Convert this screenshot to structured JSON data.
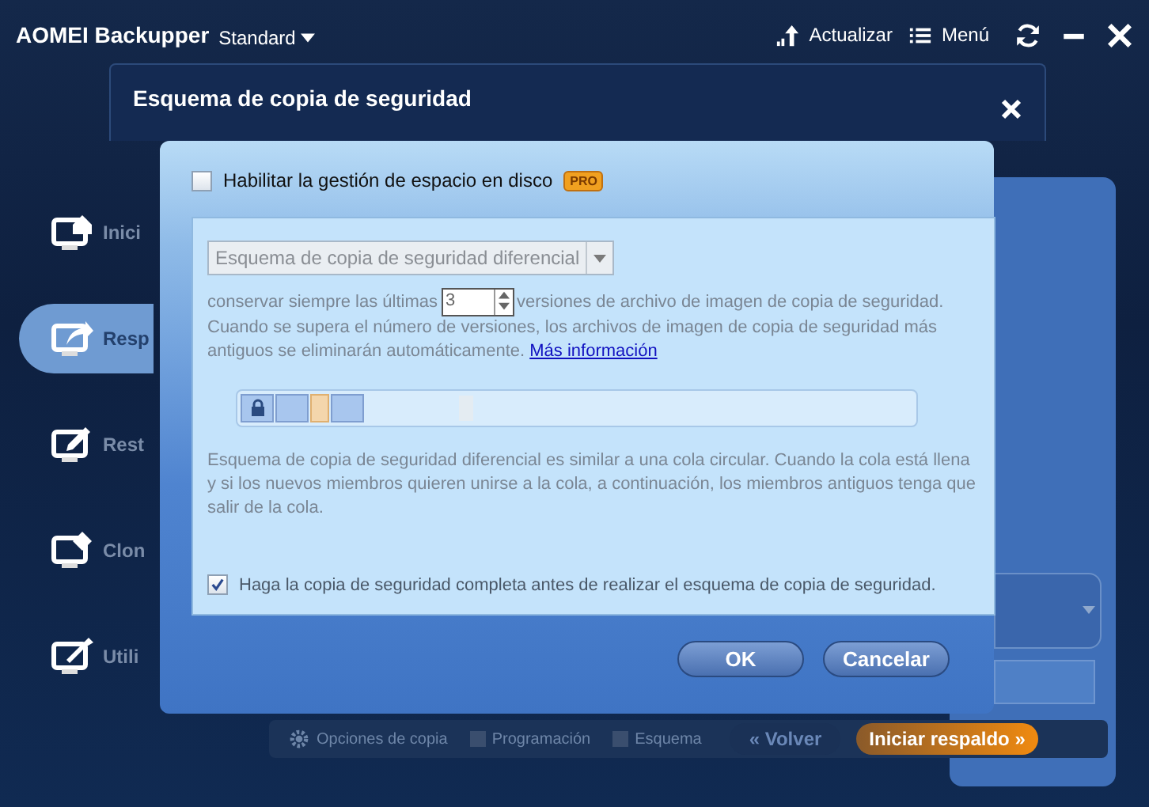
{
  "app": {
    "name": "AOMEI Backupper",
    "edition": "Standard"
  },
  "toolbar": [
    {
      "kind": "upgrade",
      "label": "Actualizar"
    },
    {
      "kind": "menu",
      "label": "Menú"
    }
  ],
  "sidebar": {
    "items": [
      {
        "kind": "home",
        "label": "Inici",
        "selected": false
      },
      {
        "kind": "backup",
        "label": "Resp",
        "selected": true
      },
      {
        "kind": "restore",
        "label": "Rest",
        "selected": false
      },
      {
        "kind": "clone",
        "label": "Clon",
        "selected": false
      },
      {
        "kind": "tools",
        "label": "Utili",
        "selected": false
      }
    ]
  },
  "dialog": {
    "title": "Esquema de copia de seguridad",
    "disk_management": {
      "label": "Habilitar la gestión de espacio en disco",
      "checked": false,
      "badge": "PRO"
    },
    "scheme": {
      "value": "Esquema de copia de seguridad diferencial",
      "disabled": true
    },
    "keep_before": "conservar siempre las últimas",
    "keep_count": "3",
    "keep_after": "versiones de archivo de imagen de copia de seguridad.",
    "explanation": "Cuando se supera el número de versiones, los archivos de imagen de copia de seguridad más antiguos se eliminarán automáticamente.",
    "more_link": "Más información",
    "queue": [
      {
        "kind": "locked"
      },
      {
        "kind": "full"
      },
      {
        "kind": "diff"
      },
      {
        "kind": "full"
      }
    ],
    "description": "Esquema de copia de seguridad diferencial es similar a una cola circular. Cuando la cola está llena y si los nuevos miembros quieren unirse a la cola, a continuación, los miembros antiguos tenga que salir de la cola.",
    "full_first": {
      "label": "Haga la copia de seguridad completa antes de realizar el esquema de copia de seguridad.",
      "checked": true
    },
    "buttons": [
      "OK",
      "Cancelar"
    ]
  },
  "bottom_bar": {
    "items": [
      {
        "kind": "options",
        "label": "Opciones de copia"
      },
      {
        "kind": "check",
        "label": "Programación",
        "checked": false
      },
      {
        "kind": "check",
        "label": "Esquema",
        "checked": false
      }
    ],
    "back": "« Volver",
    "start": "Iniciar respaldo »"
  }
}
